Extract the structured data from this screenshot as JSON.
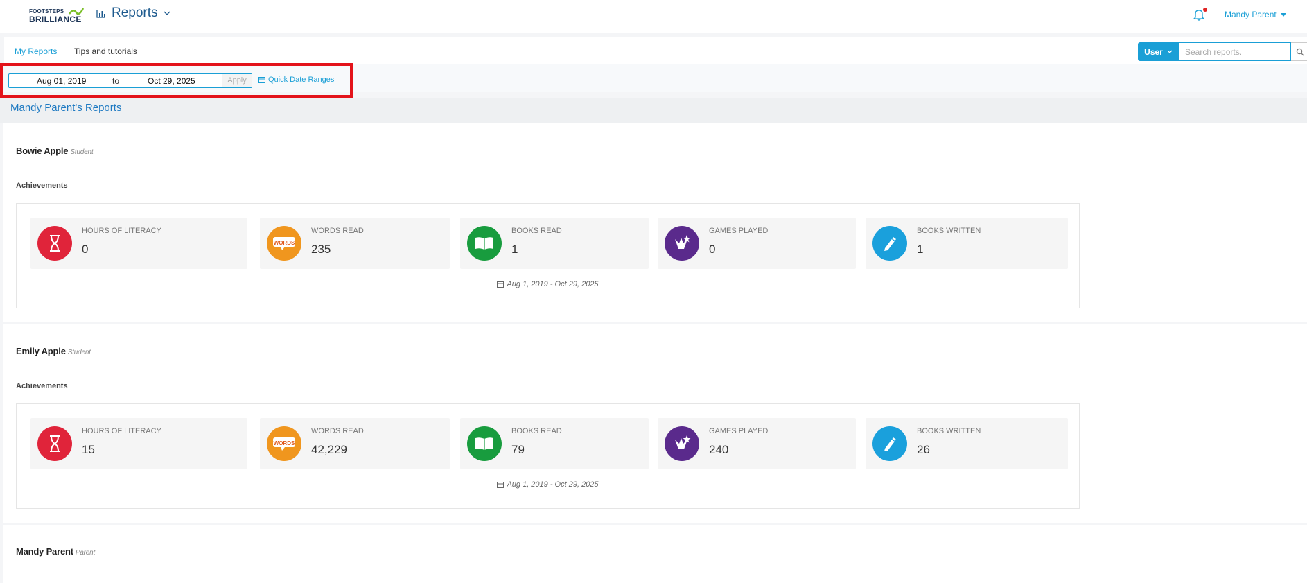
{
  "header": {
    "logo_line1": "FOOTSTEPS",
    "logo_line2": "BRILLIANCE",
    "app_title": "Reports",
    "user_name": "Mandy Parent"
  },
  "subnav": {
    "tabs": [
      {
        "label": "My Reports",
        "active": true
      },
      {
        "label": "Tips and tutorials",
        "active": false
      }
    ],
    "filter_label": "User",
    "search_placeholder": "Search reports."
  },
  "date_range": {
    "from": "Aug 01, 2019",
    "to_label": "to",
    "to": "Oct 29, 2025",
    "apply_label": "Apply",
    "quick_label": "Quick Date Ranges"
  },
  "reports_title": "Mandy Parent's Reports",
  "colors": {
    "accent": "#1a9fd6",
    "hours": "#e0243a",
    "words": "#f0961e",
    "books_read": "#189c3e",
    "games": "#5a2a8c",
    "books_written": "#1aa0dc"
  },
  "people": [
    {
      "name": "Bowie Apple",
      "role": "Student",
      "achievements_label": "Achievements",
      "range": "Aug 1, 2019 - Oct 29, 2025",
      "stats": [
        {
          "label": "Hours of Literacy",
          "value": "0",
          "icon": "hourglass-icon"
        },
        {
          "label": "Words Read",
          "value": "235",
          "icon": "words-bubble-icon"
        },
        {
          "label": "Books Read",
          "value": "1",
          "icon": "open-book-icon"
        },
        {
          "label": "Games Played",
          "value": "0",
          "icon": "game-pieces-icon"
        },
        {
          "label": "Books Written",
          "value": "1",
          "icon": "pencil-icon"
        }
      ]
    },
    {
      "name": "Emily Apple",
      "role": "Student",
      "achievements_label": "Achievements",
      "range": "Aug 1, 2019 - Oct 29, 2025",
      "stats": [
        {
          "label": "Hours of Literacy",
          "value": "15",
          "icon": "hourglass-icon"
        },
        {
          "label": "Words Read",
          "value": "42,229",
          "icon": "words-bubble-icon"
        },
        {
          "label": "Books Read",
          "value": "79",
          "icon": "open-book-icon"
        },
        {
          "label": "Games Played",
          "value": "240",
          "icon": "game-pieces-icon"
        },
        {
          "label": "Books Written",
          "value": "26",
          "icon": "pencil-icon"
        }
      ]
    },
    {
      "name": "Mandy Parent",
      "role": "Parent"
    }
  ]
}
